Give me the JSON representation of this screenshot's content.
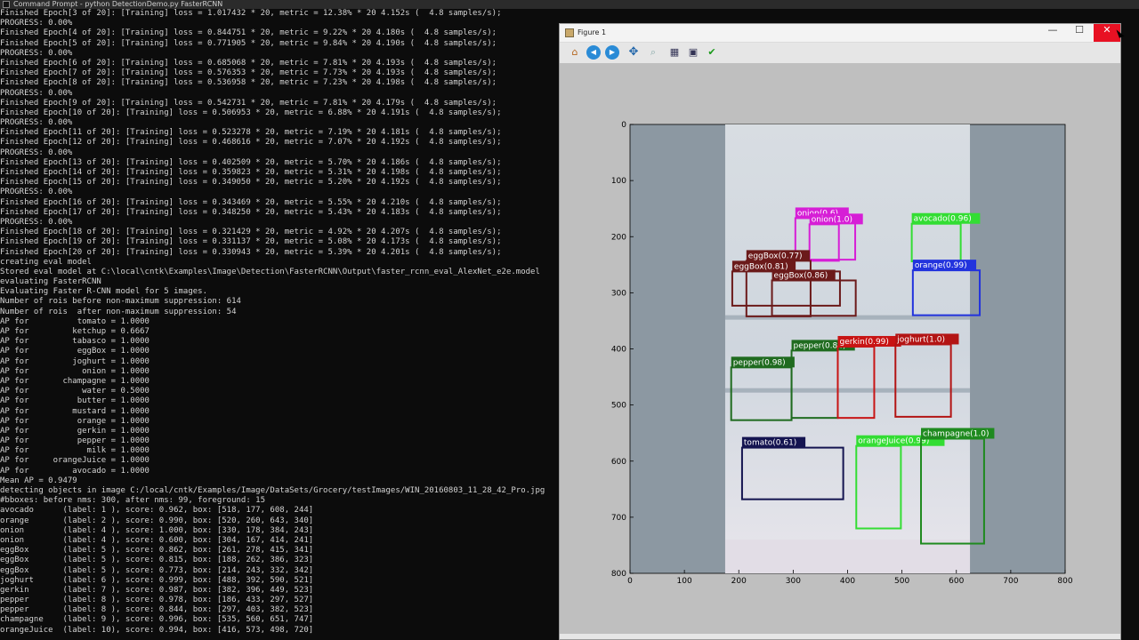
{
  "cmd_window": {
    "title": "Command Prompt - python DetectionDemo.py FasterRCNN"
  },
  "terminal_lines": [
    "Finished Epoch[3 of 20]: [Training] loss = 1.017432 * 20, metric = 12.38% * 20 4.152s (  4.8 samples/s);",
    "PROGRESS: 0.00%",
    "Finished Epoch[4 of 20]: [Training] loss = 0.844751 * 20, metric = 9.22% * 20 4.180s (  4.8 samples/s);",
    "Finished Epoch[5 of 20]: [Training] loss = 0.771905 * 20, metric = 9.84% * 20 4.190s (  4.8 samples/s);",
    "PROGRESS: 0.00%",
    "Finished Epoch[6 of 20]: [Training] loss = 0.685068 * 20, metric = 7.81% * 20 4.193s (  4.8 samples/s);",
    "Finished Epoch[7 of 20]: [Training] loss = 0.576353 * 20, metric = 7.73% * 20 4.193s (  4.8 samples/s);",
    "Finished Epoch[8 of 20]: [Training] loss = 0.536958 * 20, metric = 7.23% * 20 4.198s (  4.8 samples/s);",
    "PROGRESS: 0.00%",
    "Finished Epoch[9 of 20]: [Training] loss = 0.542731 * 20, metric = 7.81% * 20 4.179s (  4.8 samples/s);",
    "Finished Epoch[10 of 20]: [Training] loss = 0.506953 * 20, metric = 6.88% * 20 4.191s (  4.8 samples/s);",
    "PROGRESS: 0.00%",
    "Finished Epoch[11 of 20]: [Training] loss = 0.523278 * 20, metric = 7.19% * 20 4.181s (  4.8 samples/s);",
    "Finished Epoch[12 of 20]: [Training] loss = 0.468616 * 20, metric = 7.07% * 20 4.192s (  4.8 samples/s);",
    "PROGRESS: 0.00%",
    "Finished Epoch[13 of 20]: [Training] loss = 0.402509 * 20, metric = 5.70% * 20 4.186s (  4.8 samples/s);",
    "Finished Epoch[14 of 20]: [Training] loss = 0.359823 * 20, metric = 5.31% * 20 4.198s (  4.8 samples/s);",
    "Finished Epoch[15 of 20]: [Training] loss = 0.349050 * 20, metric = 5.20% * 20 4.192s (  4.8 samples/s);",
    "PROGRESS: 0.00%",
    "Finished Epoch[16 of 20]: [Training] loss = 0.343469 * 20, metric = 5.55% * 20 4.210s (  4.8 samples/s);",
    "Finished Epoch[17 of 20]: [Training] loss = 0.348250 * 20, metric = 5.43% * 20 4.183s (  4.8 samples/s);",
    "PROGRESS: 0.00%",
    "Finished Epoch[18 of 20]: [Training] loss = 0.321429 * 20, metric = 4.92% * 20 4.207s (  4.8 samples/s);",
    "Finished Epoch[19 of 20]: [Training] loss = 0.331137 * 20, metric = 5.08% * 20 4.173s (  4.8 samples/s);",
    "Finished Epoch[20 of 20]: [Training] loss = 0.330943 * 20, metric = 5.39% * 20 4.201s (  4.8 samples/s);",
    "creating eval model",
    "Stored eval model at C:\\local\\cntk\\Examples\\Image\\Detection\\FasterRCNN\\Output\\faster_rcnn_eval_AlexNet_e2e.model",
    "evaluating FasterRCNN",
    "Evaluating Faster R-CNN model for 5 images.",
    "Number of rois before non-maximum suppression: 614",
    "Number of rois  after non-maximum suppression: 54",
    "AP for          tomato = 1.0000",
    "AP for         ketchup = 0.6667",
    "AP for         tabasco = 1.0000",
    "AP for          eggBox = 1.0000",
    "AP for         joghurt = 1.0000",
    "AP for           onion = 1.0000",
    "AP for       champagne = 1.0000",
    "AP for           water = 0.5000",
    "AP for          butter = 1.0000",
    "AP for         mustard = 1.0000",
    "AP for          orange = 1.0000",
    "AP for          gerkin = 1.0000",
    "AP for          pepper = 1.0000",
    "AP for            milk = 1.0000",
    "AP for     orangeJuice = 1.0000",
    "AP for         avocado = 1.0000",
    "Mean AP = 0.9479",
    "detecting objects in image C:/local/cntk/Examples/Image/DataSets/Grocery/testImages/WIN_20160803_11_28_42_Pro.jpg",
    "#bboxes: before nms: 300, after nms: 99, foreground: 15",
    "avocado      (label: 1 ), score: 0.962, box: [518, 177, 608, 244]",
    "orange       (label: 2 ), score: 0.990, box: [520, 260, 643, 340]",
    "onion        (label: 4 ), score: 1.000, box: [330, 178, 384, 243]",
    "onion        (label: 4 ), score: 0.600, box: [304, 167, 414, 241]",
    "eggBox       (label: 5 ), score: 0.862, box: [261, 278, 415, 341]",
    "eggBox       (label: 5 ), score: 0.815, box: [188, 262, 386, 323]",
    "eggBox       (label: 5 ), score: 0.773, box: [214, 243, 332, 342]",
    "joghurt      (label: 6 ), score: 0.999, box: [488, 392, 590, 521]",
    "gerkin       (label: 7 ), score: 0.987, box: [382, 396, 449, 523]",
    "pepper       (label: 8 ), score: 0.978, box: [186, 433, 297, 527]",
    "pepper       (label: 8 ), score: 0.844, box: [297, 403, 382, 523]",
    "champagne    (label: 9 ), score: 0.996, box: [535, 560, 651, 747]",
    "orangeJuice  (label: 10), score: 0.994, box: [416, 573, 498, 720]"
  ],
  "figure_window": {
    "title": "Figure 1",
    "minimize": "—",
    "maximize": "☐",
    "close": "✕"
  },
  "toolbar": {
    "home": "⌂",
    "back": "◀",
    "forward": "▶",
    "pan": "✥",
    "zoom": "⌕",
    "subplots": "▦",
    "save": "▣",
    "edit": "✔"
  },
  "plot": {
    "x_ticks": [
      "0",
      "100",
      "200",
      "300",
      "400",
      "500",
      "600",
      "700",
      "800"
    ],
    "y_ticks": [
      "0",
      "100",
      "200",
      "300",
      "400",
      "500",
      "600",
      "700",
      "800"
    ],
    "detections": [
      {
        "label": "onion(0.6)",
        "color": "#d61ed6",
        "x1": 304,
        "y1": 167,
        "x2": 414,
        "y2": 241
      },
      {
        "label": "onion(1.0)",
        "color": "#d61ed6",
        "x1": 330,
        "y1": 178,
        "x2": 384,
        "y2": 243
      },
      {
        "label": "avocado(0.96)",
        "color": "#33dd33",
        "x1": 518,
        "y1": 177,
        "x2": 608,
        "y2": 244
      },
      {
        "label": "eggBox(0.77)",
        "color": "#6b1a1a",
        "x1": 214,
        "y1": 243,
        "x2": 332,
        "y2": 342
      },
      {
        "label": "eggBox(0.81)",
        "color": "#6b1a1a",
        "x1": 188,
        "y1": 262,
        "x2": 386,
        "y2": 323
      },
      {
        "label": "eggBox(0.86)",
        "color": "#6b1a1a",
        "x1": 261,
        "y1": 278,
        "x2": 415,
        "y2": 341
      },
      {
        "label": "orange(0.99)",
        "color": "#2233dd",
        "x1": 520,
        "y1": 260,
        "x2": 643,
        "y2": 340
      },
      {
        "label": "pepper(0.84)",
        "color": "#1f6b1f",
        "x1": 297,
        "y1": 403,
        "x2": 382,
        "y2": 523
      },
      {
        "label": "gerkin(0.99)",
        "color": "#c81414",
        "x1": 382,
        "y1": 396,
        "x2": 449,
        "y2": 523
      },
      {
        "label": "joghurt(1.0)",
        "color": "#b31414",
        "x1": 488,
        "y1": 392,
        "x2": 590,
        "y2": 521
      },
      {
        "label": "pepper(0.98)",
        "color": "#1f6b1f",
        "x1": 186,
        "y1": 433,
        "x2": 297,
        "y2": 527
      },
      {
        "label": "tomato(0.61)",
        "color": "#141450",
        "x1": 206,
        "y1": 576,
        "x2": 392,
        "y2": 668
      },
      {
        "label": "orangeJuice(0.99)",
        "color": "#33dd33",
        "x1": 416,
        "y1": 573,
        "x2": 498,
        "y2": 720
      },
      {
        "label": "champagne(1.0)",
        "color": "#1f8a1f",
        "x1": 535,
        "y1": 560,
        "x2": 651,
        "y2": 747
      }
    ]
  }
}
